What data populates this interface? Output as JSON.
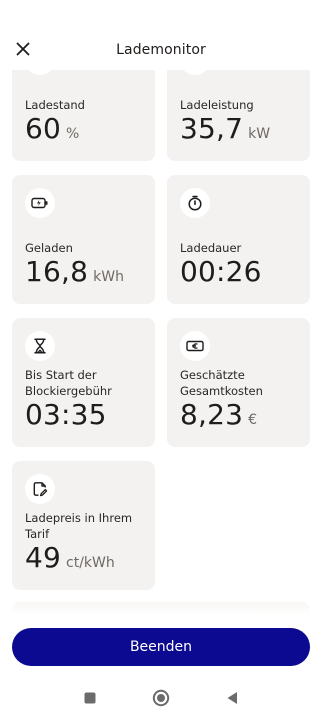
{
  "header": {
    "title": "Lademonitor",
    "close_icon": "close-icon"
  },
  "cards": [
    {
      "id": "ladestand",
      "icon": "battery-level-icon",
      "label": "Ladestand",
      "value": "60",
      "unit": "%"
    },
    {
      "id": "ladeleistung",
      "icon": "power-icon",
      "label": "Ladeleistung",
      "value": "35,7",
      "unit": "kW"
    },
    {
      "id": "geladen",
      "icon": "battery-charging-icon",
      "label": "Geladen",
      "value": "16,8",
      "unit": "kWh"
    },
    {
      "id": "ladedauer",
      "icon": "stopwatch-icon",
      "label": "Ladedauer",
      "value": "00:26",
      "unit": ""
    },
    {
      "id": "blockiergebuehr",
      "icon": "hourglass-icon",
      "label": "Bis Start der Blockiergebühr",
      "value": "03:35",
      "unit": ""
    },
    {
      "id": "gesamtkosten",
      "icon": "banknote-icon",
      "label": "Geschätzte Gesamtkosten",
      "value": "8,23",
      "unit": "€"
    },
    {
      "id": "ladepreis",
      "icon": "tariff-edit-icon",
      "label": "Ladepreis in Ihrem Tarif",
      "value": "49",
      "unit": "ct/kWh"
    }
  ],
  "actions": {
    "end_label": "Beenden"
  },
  "colors": {
    "primary": "#0c0a91",
    "card_bg": "#f4f2f0"
  },
  "system_nav": [
    "recent-apps-icon",
    "home-icon",
    "back-icon"
  ]
}
